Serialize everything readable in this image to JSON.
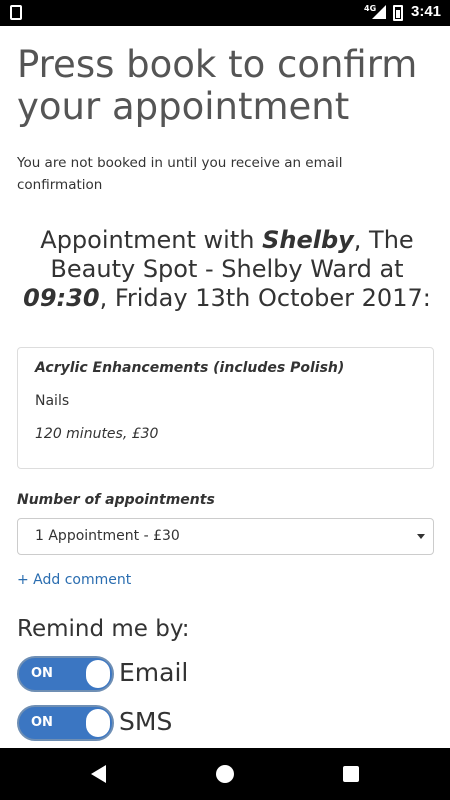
{
  "status_bar": {
    "network": "4G",
    "time": "3:41",
    "icons": [
      "sd-card-icon",
      "signal-icon",
      "battery-icon"
    ]
  },
  "header": {
    "title": "Press book to confirm your appointment",
    "notice": "You are not booked in until you receive an email confirmation"
  },
  "appointment": {
    "prefix": "Appointment with ",
    "staff": "Shelby",
    "location": ", The Beauty Spot - Shelby Ward at ",
    "time": "09:30",
    "date": ", Friday 13th October 2017:"
  },
  "service": {
    "name": "Acrylic Enhancements (includes Polish)",
    "category": "Nails",
    "duration_price": "120 minutes, £30"
  },
  "booking": {
    "number_label": "Number of appointments",
    "selected_option": "1 Appointment - £30",
    "add_comment": "+ Add comment"
  },
  "reminders": {
    "label": "Remind me by:",
    "options": [
      {
        "state": "ON",
        "label": "Email",
        "enabled": true
      },
      {
        "state": "ON",
        "label": "SMS",
        "enabled": true
      }
    ]
  },
  "colors": {
    "accent": "#3b76c2",
    "link": "#2a6db0",
    "text": "#333333"
  },
  "nav_bar": {
    "icons": [
      "back-icon",
      "home-icon",
      "recent-apps-icon"
    ]
  }
}
